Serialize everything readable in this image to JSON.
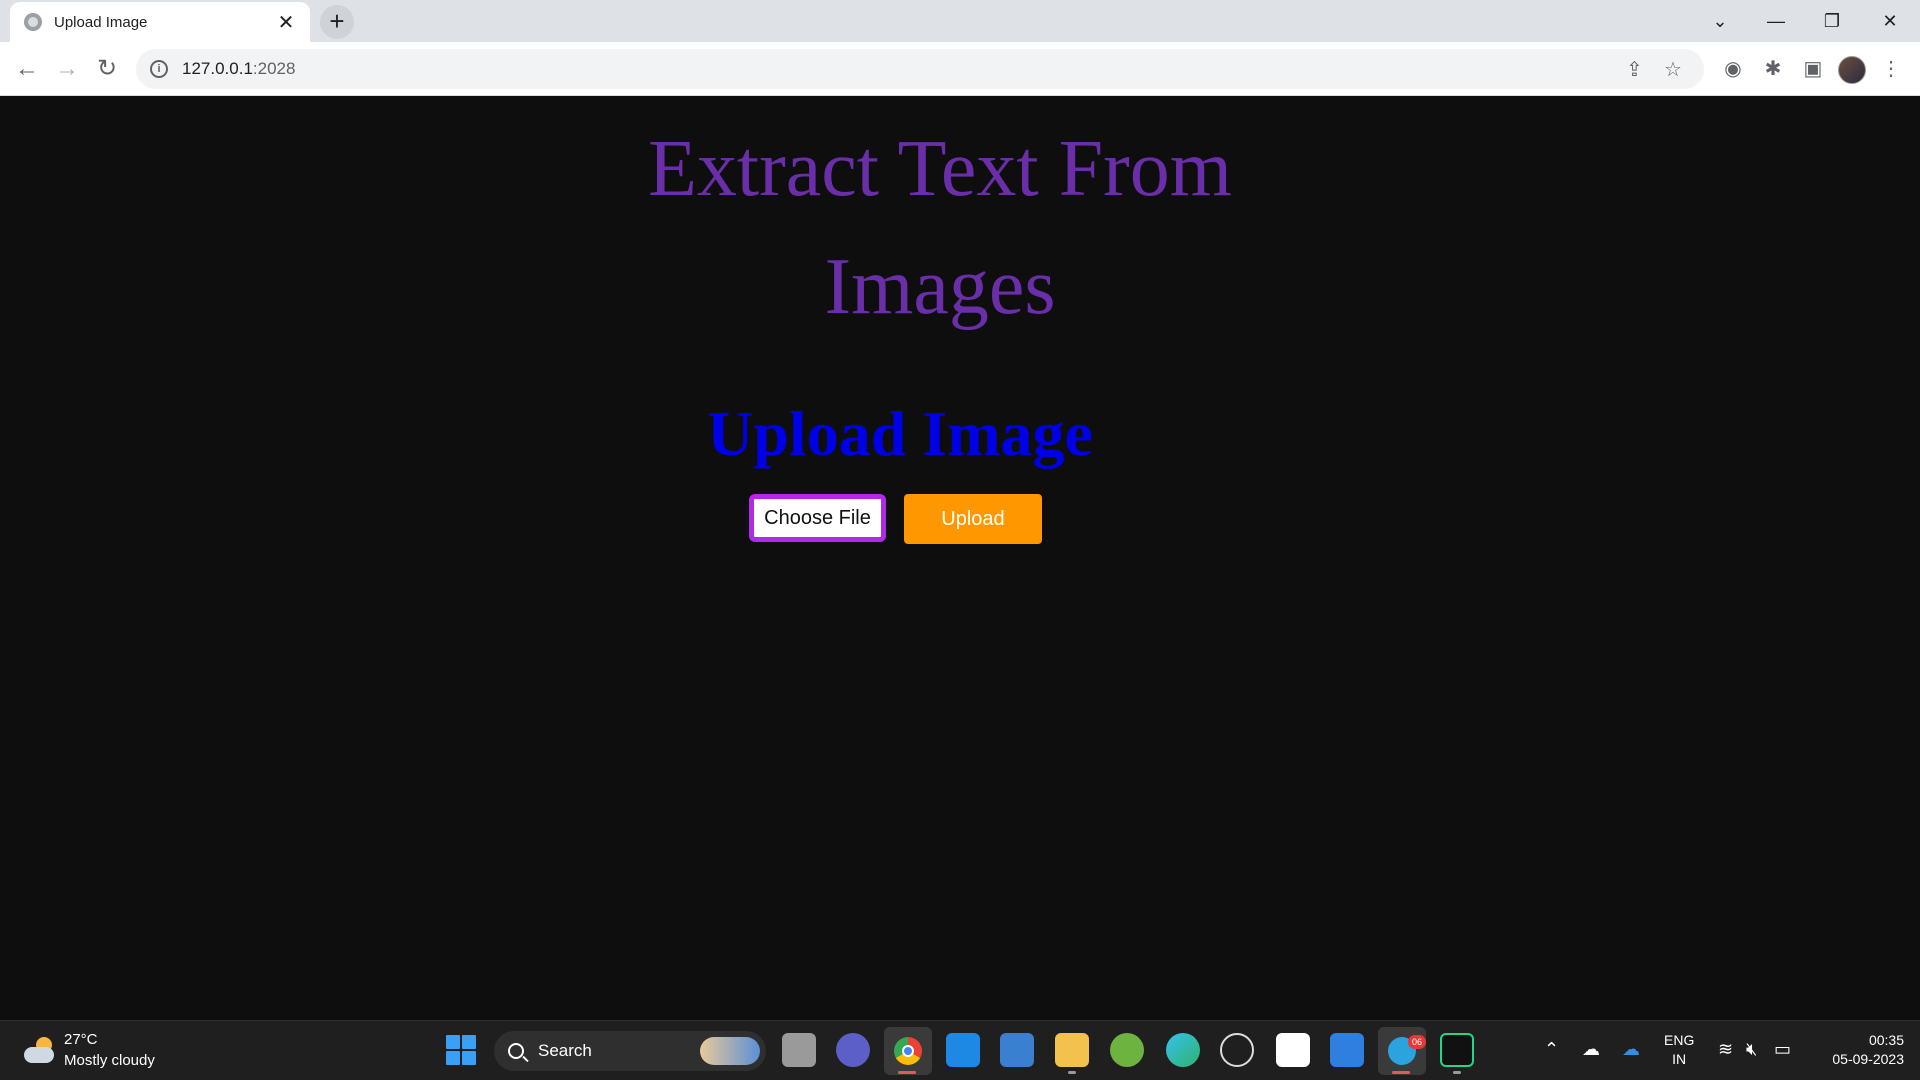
{
  "browser": {
    "tab_title": "Upload Image",
    "url_host": "127.0.0.1",
    "url_port": ":2028"
  },
  "page": {
    "heading": "Extract Text From Images",
    "subheading": "Upload Image",
    "choose_file_label": "Choose File",
    "upload_label": "Upload",
    "colors": {
      "background": "#0e0e0e",
      "heading": "#6a2fa8",
      "subheading": "#0000e8",
      "choose_border": "#b02ae8",
      "upload_button": "#ff9800"
    }
  },
  "taskbar": {
    "weather_temp": "27°C",
    "weather_desc": "Mostly cloudy",
    "search_label": "Search",
    "lang_line1": "ENG",
    "lang_line2": "IN",
    "time": "00:35",
    "date": "05-09-2023",
    "telegram_badge": "06"
  },
  "icons": [
    "back-icon",
    "forward-icon",
    "reload-icon",
    "info-icon",
    "share-icon",
    "star-icon",
    "extension-icon",
    "sidepanel-icon",
    "menu-icon",
    "windows-start-icon",
    "search-icon",
    "chrome-icon",
    "mail-icon",
    "folder-icon",
    "edge-icon",
    "telegram-icon",
    "pycharm-icon",
    "wifi-icon",
    "volume-icon",
    "battery-icon"
  ]
}
